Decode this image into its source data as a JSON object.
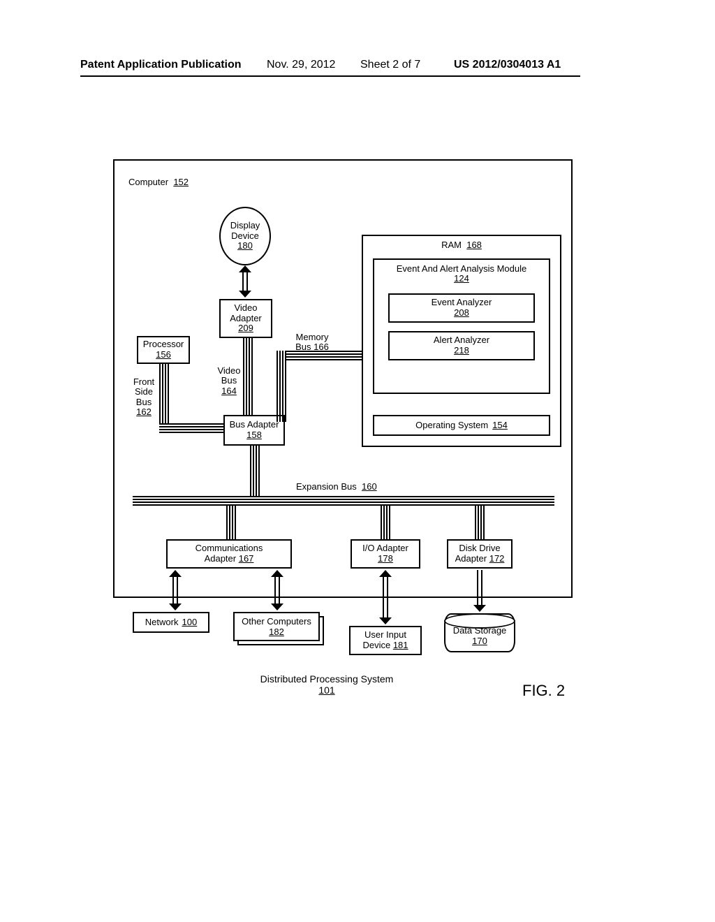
{
  "header": {
    "publication_label": "Patent Application Publication",
    "date": "Nov. 29, 2012",
    "sheet": "Sheet 2 of 7",
    "number": "US 2012/0304013 A1"
  },
  "figure_label": "FIG. 2",
  "caption": {
    "text": "Distributed Processing System",
    "num": "101"
  },
  "blocks": {
    "computer": {
      "label": "Computer",
      "num": "152"
    },
    "display": {
      "label": "Display Device",
      "num": "180"
    },
    "video_adapter": {
      "label": "Video Adapter",
      "num": "209"
    },
    "processor": {
      "label": "Processor",
      "num": "156"
    },
    "bus_adapter": {
      "label": "Bus Adapter",
      "num": "158"
    },
    "ram": {
      "label": "RAM",
      "num": "168"
    },
    "eaa_module": {
      "label": "Event And Alert Analysis Module",
      "num": "124"
    },
    "event_analyzer": {
      "label": "Event Analyzer",
      "num": "208"
    },
    "alert_analyzer": {
      "label": "Alert Analyzer",
      "num": "218"
    },
    "os": {
      "label": "Operating System",
      "num": "154"
    },
    "comm_adapter": {
      "label": "Communications Adapter",
      "num": "167"
    },
    "io_adapter": {
      "label": "I/O Adapter",
      "num": "178"
    },
    "disk_adapter": {
      "label": "Disk Drive Adapter",
      "num": "172"
    },
    "network": {
      "label": "Network",
      "num": "100"
    },
    "other_computers": {
      "label": "Other Computers",
      "num": "182"
    },
    "user_input": {
      "label": "User Input Device",
      "num": "181"
    },
    "data_storage": {
      "label": "Data Storage",
      "num": "170"
    }
  },
  "bus_labels": {
    "front_side_bus": {
      "label": "Front Side Bus",
      "num": "162"
    },
    "video_bus": {
      "label": "Video Bus",
      "num": "164"
    },
    "memory_bus": {
      "label": "Memory Bus",
      "num": "166"
    },
    "expansion_bus": {
      "label": "Expansion Bus",
      "num": "160"
    }
  }
}
